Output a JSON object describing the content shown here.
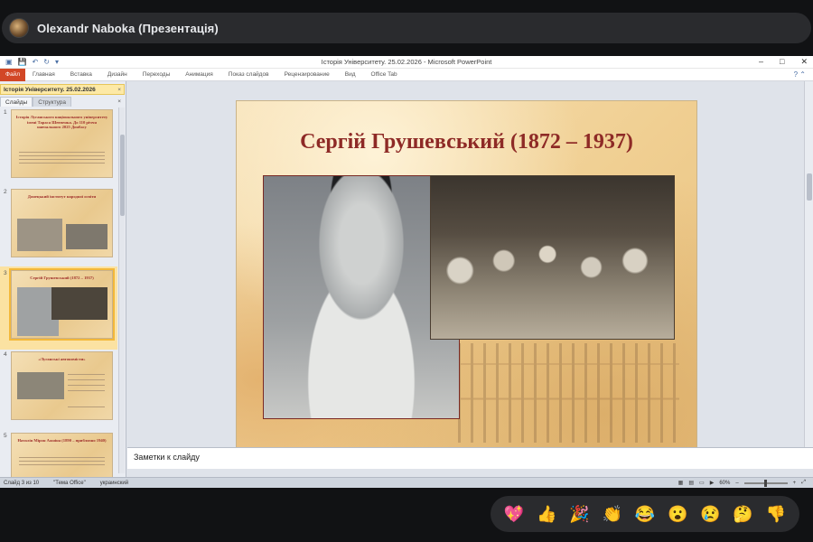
{
  "meet": {
    "presenter": "Olexandr Naboka (Презентація)"
  },
  "window": {
    "title": "Історія Університету. 25.02.2026 - Microsoft PowerPoint",
    "controls": [
      "–",
      "□",
      "✕"
    ]
  },
  "ribbon": {
    "file": "Файл",
    "tabs": [
      "Главная",
      "Вставка",
      "Дизайн",
      "Переходы",
      "Анимация",
      "Показ слайдов",
      "Рецензирование",
      "Вид",
      "Office Tab"
    ]
  },
  "left_panel": {
    "doc_tab": "Історія Університету. 25.02.2026",
    "pane_tabs": [
      "Слайды",
      "Структура"
    ],
    "slides": [
      {
        "num": "1",
        "title": "Історія Луганського національного університету імені Тараса Шевченка. До 110 річчя навчального 2025 Донбасу"
      },
      {
        "num": "2",
        "title": "Донецький інститут народної освіти"
      },
      {
        "num": "3",
        "title": "Сергій Грушевський (1872 – 1937)"
      },
      {
        "num": "4",
        "title": "«Луганські автономісти»"
      },
      {
        "num": "5",
        "title": "Наталія Мірон Ажніна (1890 – приблизно 1940)"
      }
    ],
    "selected_index": 3
  },
  "slide": {
    "title": "Сергій Грушевський (1872 – 1937)"
  },
  "notes": {
    "placeholder": "Заметки к слайду"
  },
  "status": {
    "slide_counter": "Слайд 3 из 10",
    "theme": "\"Тема Office\"",
    "language": "украинский",
    "zoom": "60%"
  },
  "reactions": [
    {
      "name": "heart",
      "glyph": "💖"
    },
    {
      "name": "thumbs-up",
      "glyph": "👍"
    },
    {
      "name": "party",
      "glyph": "🎉"
    },
    {
      "name": "clap",
      "glyph": "👏"
    },
    {
      "name": "laugh",
      "glyph": "😂"
    },
    {
      "name": "surprised",
      "glyph": "😮"
    },
    {
      "name": "sad",
      "glyph": "😢"
    },
    {
      "name": "thinking",
      "glyph": "🤔"
    },
    {
      "name": "thumbs-down",
      "glyph": "👎"
    }
  ]
}
